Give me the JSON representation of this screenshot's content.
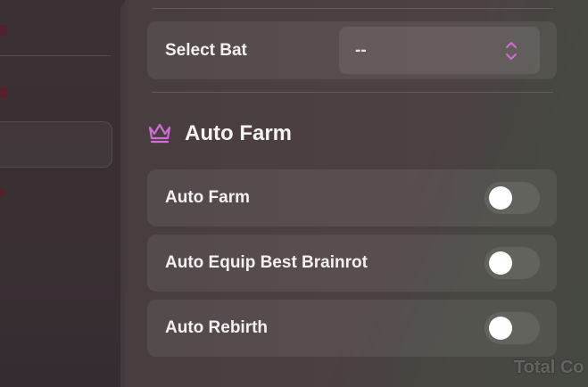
{
  "select_bat": {
    "label": "Select Bat",
    "value": "--"
  },
  "section": {
    "title": "Auto Farm",
    "icon": "crown-icon",
    "accent_color": "#d26ad8"
  },
  "toggles": [
    {
      "label": "Auto Farm",
      "checked": false
    },
    {
      "label": "Auto Equip Best Brainrot",
      "checked": false
    },
    {
      "label": "Auto Rebirth",
      "checked": false
    }
  ],
  "background": {
    "watermark_text": "Total Co"
  }
}
